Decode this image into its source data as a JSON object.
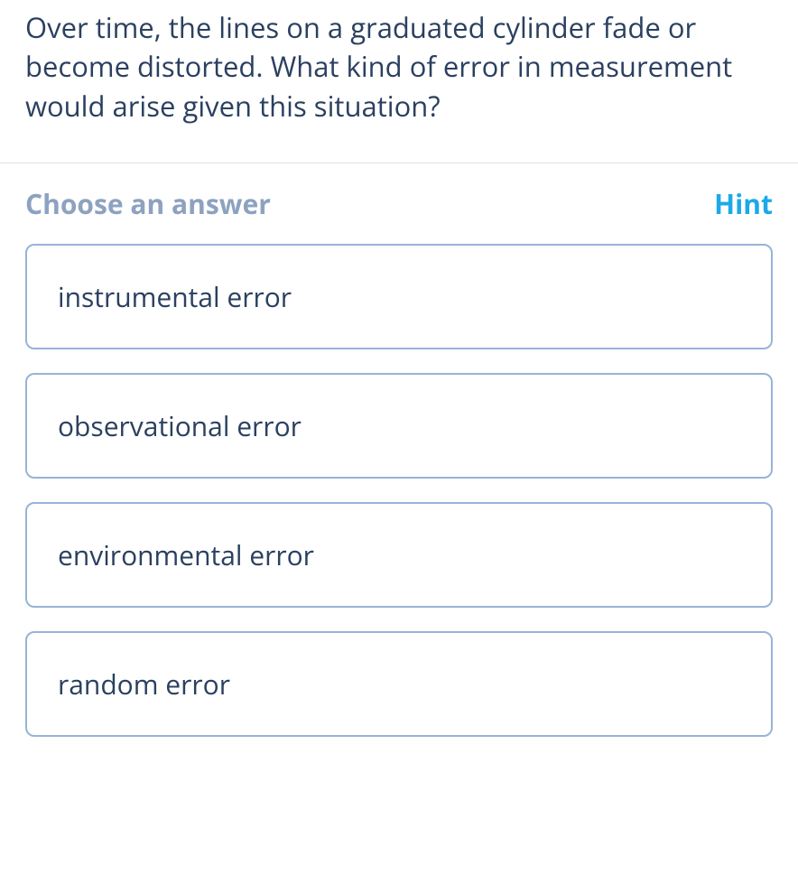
{
  "question": {
    "text": "Over time, the lines on a graduated cylinder fade or become distorted. What kind of error in measurement would arise given this situation?"
  },
  "answer_header": {
    "choose_label": "Choose an answer",
    "hint_label": "Hint"
  },
  "options": [
    {
      "label": "instrumental error"
    },
    {
      "label": "observational error"
    },
    {
      "label": "environmental error"
    },
    {
      "label": "random error"
    }
  ]
}
